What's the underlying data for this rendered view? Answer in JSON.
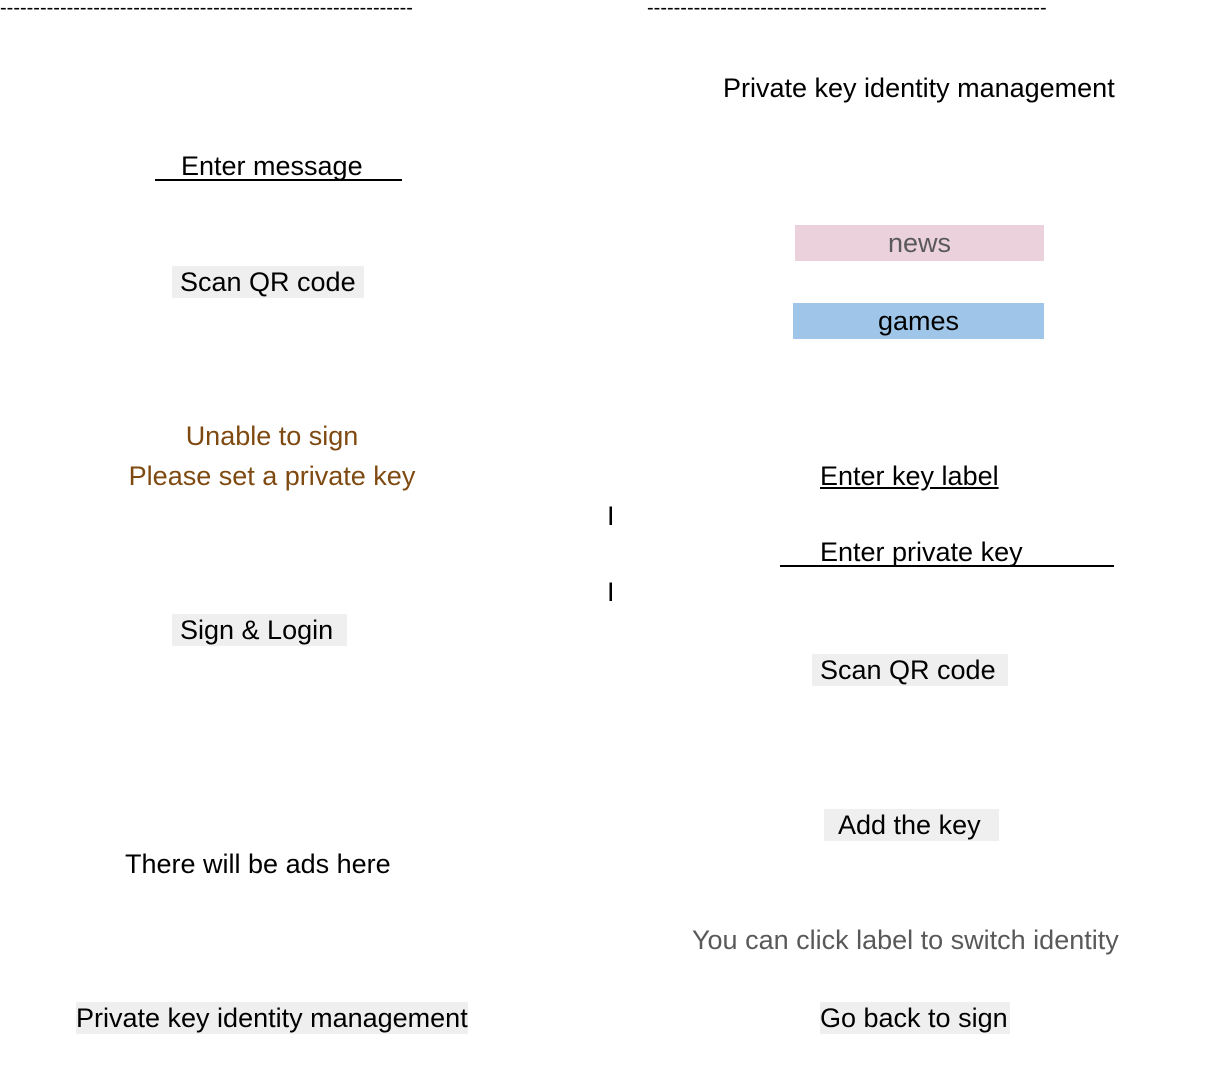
{
  "left_panel": {
    "divider": "--------------------------------------------------------------",
    "message_input_placeholder": "Enter message",
    "scan_qr_label": "Scan QR code",
    "status": {
      "line1": "Unable to sign",
      "line2": "Please set a private key",
      "color": "#7f4a12"
    },
    "sign_login_label": "Sign & Login",
    "ads_text": "There will be ads here",
    "manage_link_label": "Private key identity management"
  },
  "center": {
    "separator_1": "I",
    "separator_2": "I"
  },
  "right_panel": {
    "divider": "------------------------------------------------------------",
    "title": "Private key identity management",
    "key_labels": [
      {
        "label": "news",
        "color": "#ead1dc"
      },
      {
        "label": "games",
        "color": "#9fc5e8"
      }
    ],
    "key_label_input_placeholder": "Enter key label",
    "private_key_input_placeholder": "Enter private key",
    "scan_qr_label": "Scan QR code",
    "add_key_label": "Add the key",
    "hint": "You can click label to switch identity",
    "back_label": "Go back to sign"
  }
}
